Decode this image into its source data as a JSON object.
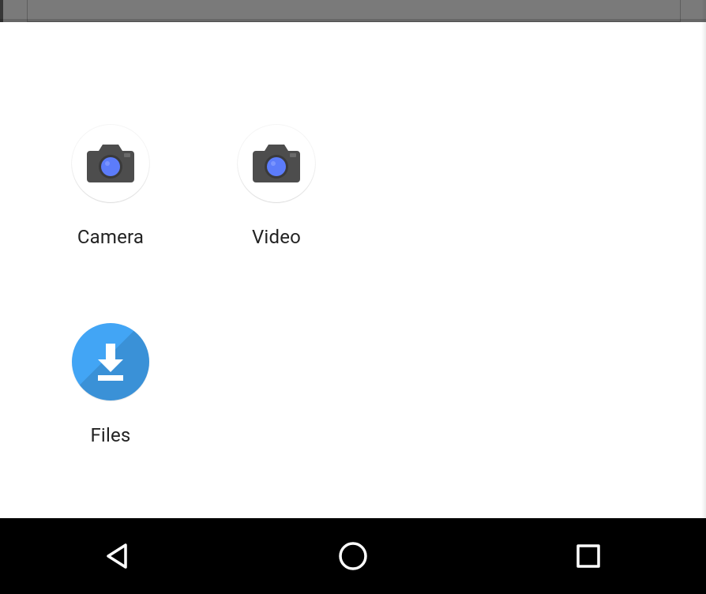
{
  "chooser": {
    "options": [
      {
        "id": "camera",
        "label": "Camera",
        "icon": "camera-icon"
      },
      {
        "id": "video",
        "label": "Video",
        "icon": "camera-icon"
      },
      {
        "id": "files",
        "label": "Files",
        "icon": "download-icon"
      }
    ]
  },
  "navbar": {
    "back": "back-icon",
    "home": "home-icon",
    "recent": "recent-icon"
  },
  "colors": {
    "files_accent": "#42a5f5",
    "camera_body": "#4d4d4d",
    "camera_lens": "#5c7cfa",
    "nav_bg": "#000000",
    "nav_fg": "#ffffff"
  }
}
